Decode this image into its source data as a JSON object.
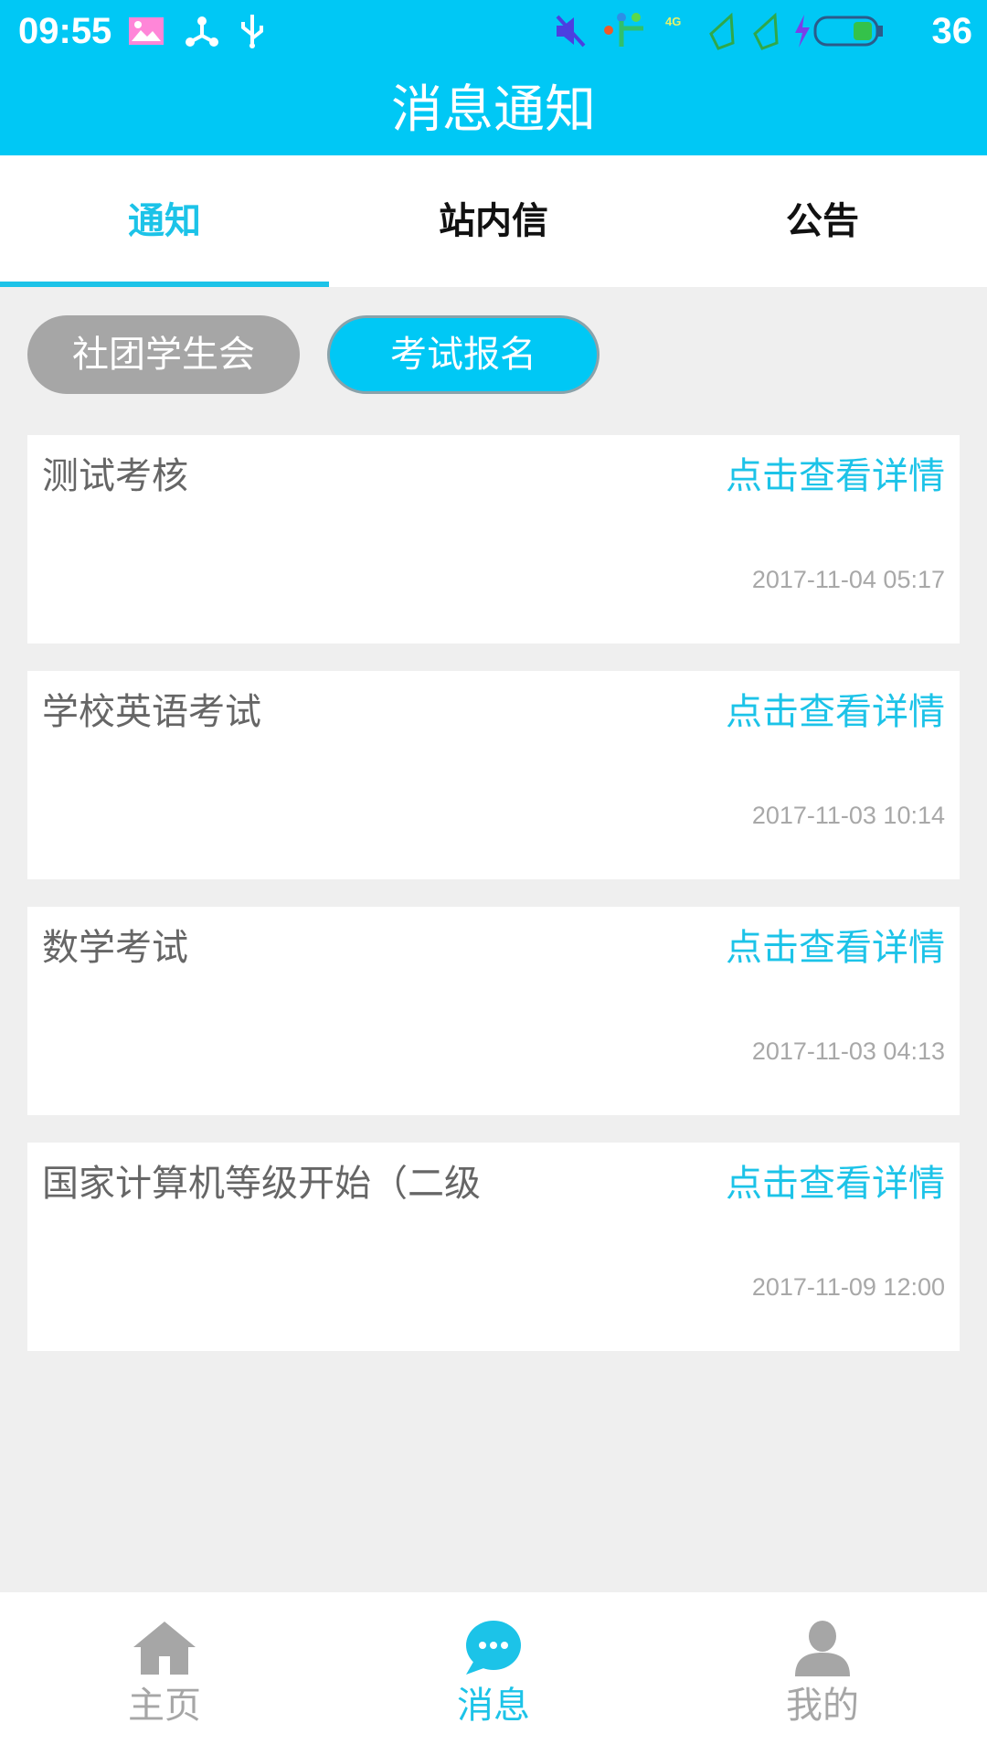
{
  "status_bar": {
    "time": "09:55",
    "battery_level": "36",
    "network_label": "4G"
  },
  "header": {
    "title": "消息通知"
  },
  "tabs": [
    {
      "label": "通知",
      "active": true
    },
    {
      "label": "站内信",
      "active": false
    },
    {
      "label": "公告",
      "active": false
    }
  ],
  "filters": [
    {
      "label": "社团学生会",
      "active": false
    },
    {
      "label": "考试报名",
      "active": true
    }
  ],
  "messages": [
    {
      "title": "测试考核",
      "link": "点击查看详情",
      "time": "2017-11-04 05:17"
    },
    {
      "title": "学校英语考试",
      "link": "点击查看详情",
      "time": "2017-11-03 10:14"
    },
    {
      "title": "数学考试",
      "link": "点击查看详情",
      "time": "2017-11-03 04:13"
    },
    {
      "title": "国家计算机等级开始（二级",
      "link": "点击查看详情",
      "time": "2017-11-09 12:00"
    }
  ],
  "bottom_nav": [
    {
      "label": "主页",
      "icon": "home-icon",
      "active": false
    },
    {
      "label": "消息",
      "icon": "chat-bubble-icon",
      "active": true
    },
    {
      "label": "我的",
      "icon": "user-icon",
      "active": false
    }
  ],
  "colors": {
    "accent": "#00c8f5",
    "accent_text": "#1cc3e8",
    "inactive_chip": "#a6a6a6",
    "page_background": "#efefef",
    "nav_inactive": "#a6a6a6"
  }
}
